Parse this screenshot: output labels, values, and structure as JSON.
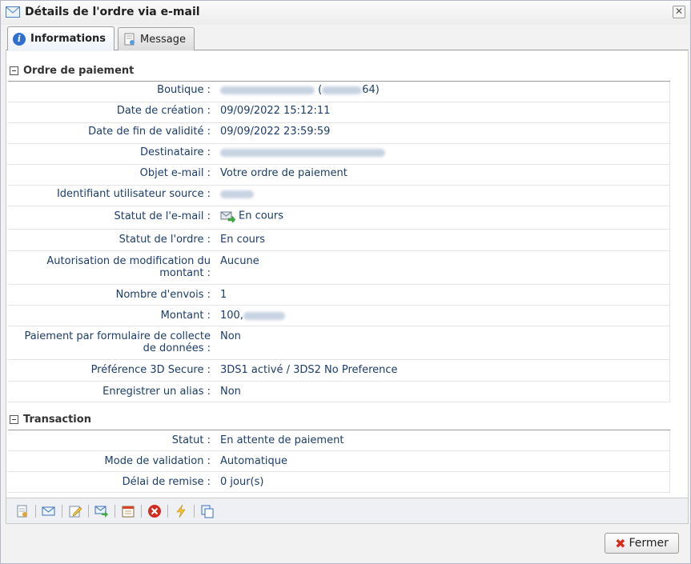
{
  "window": {
    "title": "Détails de l'ordre via e-mail"
  },
  "tabs": [
    {
      "label": "Informations",
      "active": true,
      "icon": "info-icon"
    },
    {
      "label": "Message",
      "active": false,
      "icon": "message-icon"
    }
  ],
  "sections": {
    "payment_order": {
      "title": "Ordre de paiement",
      "rows": [
        {
          "label": "Boutique :",
          "value_suffix": "64)",
          "value_prefix": "("
        },
        {
          "label": "Date de création :",
          "value": "09/09/2022 15:12:11"
        },
        {
          "label": "Date de fin de validité :",
          "value": "09/09/2022 23:59:59"
        },
        {
          "label": "Destinataire :",
          "value": ""
        },
        {
          "label": "Objet e-mail :",
          "value": "Votre ordre de paiement"
        },
        {
          "label": "Identifiant utilisateur source :",
          "value": ""
        },
        {
          "label": "Statut de l'e-mail :",
          "value": "En cours"
        },
        {
          "label": "Statut de l'ordre :",
          "value": "En cours"
        },
        {
          "label": "Autorisation de modification du montant :",
          "value": "Aucune"
        },
        {
          "label": "Nombre d'envois :",
          "value": "1"
        },
        {
          "label": "Montant :",
          "value": "100,"
        },
        {
          "label": "Paiement par formulaire de collecte de données :",
          "value": "Non"
        },
        {
          "label": "Préférence 3D Secure :",
          "value": "3DS1 activé / 3DS2 No Preference"
        },
        {
          "label": "Enregistrer un alias :",
          "value": "Non"
        }
      ]
    },
    "transaction": {
      "title": "Transaction",
      "rows": [
        {
          "label": "Statut :",
          "value": "En attente de paiement"
        },
        {
          "label": "Mode de validation :",
          "value": "Automatique"
        },
        {
          "label": "Délai de remise :",
          "value": "0 jour(s)"
        }
      ]
    }
  },
  "toolbar": {
    "buttons": [
      "details-icon",
      "send-email-icon",
      "edit-icon",
      "forward-email-icon",
      "calendar-icon",
      "cancel-icon",
      "lightning-icon",
      "duplicate-icon"
    ]
  },
  "footer": {
    "close_label": "Fermer"
  },
  "colors": {
    "label_text": "#1c3d6b",
    "accent_blue": "#2f6fd0",
    "cancel_red": "#d62b1f"
  }
}
